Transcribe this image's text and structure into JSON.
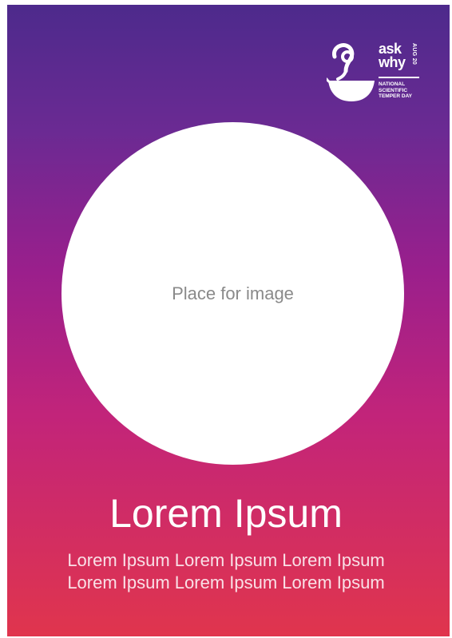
{
  "colors": {
    "gradient_top": "#4d2a8c",
    "gradient_mid": "#9a1f8c",
    "gradient_bottom": "#e0354d",
    "placeholder_fill": "#ffffff",
    "placeholder_text": "#8a8a8a"
  },
  "logo": {
    "icon": "lamp-question-icon",
    "line1": "ask",
    "line2": "why",
    "date": "AUG 20",
    "tagline": [
      "NATIONAL",
      "SCIENTIFIC",
      "TEMPER DAY"
    ]
  },
  "image_placeholder": {
    "label": "Place for image"
  },
  "headline": "Lorem Ipsum",
  "body_lines": [
    "Lorem Ipsum Lorem Ipsum Lorem Ipsum",
    "Lorem Ipsum Lorem Ipsum Lorem Ipsum"
  ]
}
